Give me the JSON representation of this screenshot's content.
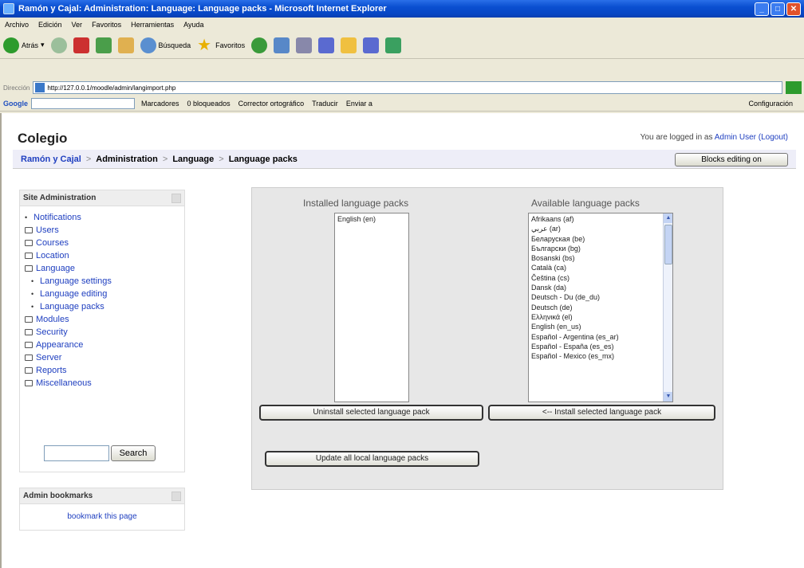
{
  "window": {
    "title": "Ramón y Cajal: Administration: Language: Language packs - Microsoft Internet Explorer"
  },
  "menubar": [
    "Archivo",
    "Edición",
    "Ver",
    "Favoritos",
    "Herramientas",
    "Ayuda"
  ],
  "toolbar": {
    "back_label": "Atrás",
    "search_label": "Búsqueda",
    "favorites_label": "Favoritos"
  },
  "address": {
    "label": "Dirección",
    "url": "http://127.0.0.1/moodle/admin/langimport.php"
  },
  "googlebar": {
    "logo": "Google",
    "items": [
      "Marcadores",
      "0 bloqueados",
      "Corrector ortográfico",
      "Traducir",
      "Enviar a"
    ],
    "config_label": "Configuración"
  },
  "page": {
    "site_title": "Colegio",
    "login_prefix": "You are logged in as ",
    "login_user": "Admin User",
    "logout": "(Logout)",
    "breadcrumb": [
      "Ramón y Cajal",
      "Administration",
      "Language",
      "Language packs"
    ],
    "blocks_editing_button": "Blocks editing on"
  },
  "site_admin": {
    "header": "Site Administration",
    "items": [
      {
        "label": "Notifications",
        "type": "bullet"
      },
      {
        "label": "Users",
        "type": "folder"
      },
      {
        "label": "Courses",
        "type": "folder"
      },
      {
        "label": "Location",
        "type": "folder"
      },
      {
        "label": "Language",
        "type": "folder-open"
      },
      {
        "label": "Language settings",
        "type": "sub"
      },
      {
        "label": "Language editing",
        "type": "sub"
      },
      {
        "label": "Language packs",
        "type": "sub"
      },
      {
        "label": "Modules",
        "type": "folder"
      },
      {
        "label": "Security",
        "type": "folder"
      },
      {
        "label": "Appearance",
        "type": "folder"
      },
      {
        "label": "Server",
        "type": "folder"
      },
      {
        "label": "Reports",
        "type": "folder"
      },
      {
        "label": "Miscellaneous",
        "type": "folder"
      }
    ],
    "search_button": "Search"
  },
  "admin_bookmarks": {
    "header": "Admin bookmarks",
    "link": "bookmark this page"
  },
  "langpacks": {
    "installed_label": "Installed language packs",
    "available_label": "Available language packs",
    "installed": [
      "English (en)"
    ],
    "available": [
      "Afrikaans (af)",
      "عربي (ar)",
      "Беларуская (be)",
      "Български (bg)",
      "Bosanski (bs)",
      "Català (ca)",
      "Čeština (cs)",
      "Dansk (da)",
      "Deutsch - Du (de_du)",
      "Deutsch (de)",
      "Ελληνικά (el)",
      "English (en_us)",
      "Español - Argentina (es_ar)",
      "Español - España (es_es)",
      "Español - Mexico (es_mx)"
    ],
    "uninstall_button": "Uninstall selected language pack",
    "install_button": "<-- Install selected language pack",
    "update_button": "Update all local language packs"
  }
}
